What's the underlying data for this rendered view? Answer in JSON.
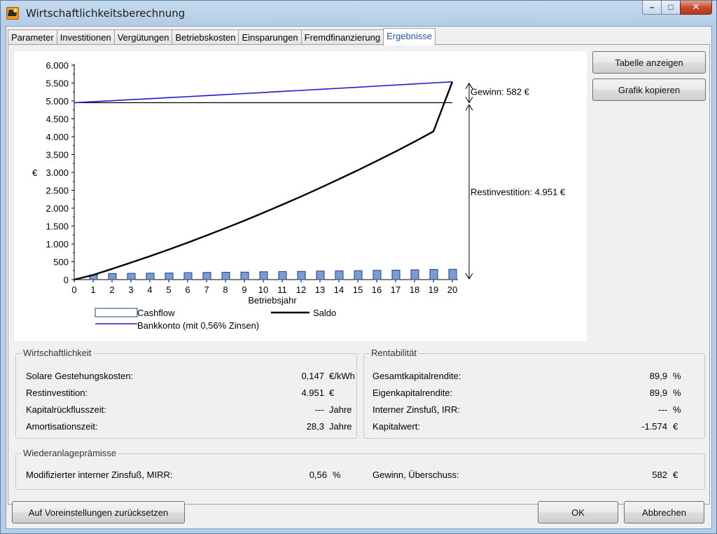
{
  "window": {
    "title": "Wirtschaftlichkeitsberechnung"
  },
  "tabs": [
    "Parameter",
    "Investitionen",
    "Vergütungen",
    "Betriebskosten",
    "Einsparungen",
    "Fremdfinanzierung",
    "Ergebnisse"
  ],
  "active_tab": "Ergebnisse",
  "buttons": {
    "show_table": "Tabelle anzeigen",
    "copy_chart": "Grafik kopieren",
    "reset": "Auf Voreinstellungen zurücksetzen",
    "ok": "OK",
    "cancel": "Abbrechen"
  },
  "colors": {
    "bankkonto": "#1c1cd6",
    "saldo": "#000000",
    "cashflow_fill": "#7a9cd0",
    "cashflow_stroke": "#1f3f8a",
    "active_tab_text": "#1f56a6"
  },
  "chart_data": {
    "type": "bar+line",
    "xlabel": "Betriebsjahr",
    "ylabel": "€",
    "x": [
      0,
      1,
      2,
      3,
      4,
      5,
      6,
      7,
      8,
      9,
      10,
      11,
      12,
      13,
      14,
      15,
      16,
      17,
      18,
      19,
      20
    ],
    "ylim": [
      0,
      6000
    ],
    "yticks": [
      0,
      500,
      1000,
      1500,
      2000,
      2500,
      3000,
      3500,
      4000,
      4500,
      5000,
      5500,
      6000
    ],
    "ytick_labels": [
      "0",
      "500",
      "1.000",
      "1.500",
      "2.000",
      "2.500",
      "3.000",
      "3.500",
      "4.000",
      "4.500",
      "5.000",
      "5.500",
      "6.000"
    ],
    "reference_line": 4951,
    "series": [
      {
        "name": "Cashflow",
        "type": "bar",
        "x": [
          1,
          2,
          3,
          4,
          5,
          6,
          7,
          8,
          9,
          10,
          11,
          12,
          13,
          14,
          15,
          16,
          17,
          18,
          19,
          20
        ],
        "values": [
          130,
          170,
          175,
          180,
          185,
          195,
          200,
          205,
          210,
          220,
          225,
          230,
          240,
          245,
          250,
          260,
          265,
          275,
          285,
          290
        ]
      },
      {
        "name": "Saldo",
        "type": "line",
        "values": [
          0,
          130,
          300,
          475,
          655,
          840,
          1035,
          1235,
          1440,
          1650,
          1870,
          2095,
          2325,
          2565,
          2810,
          3060,
          3320,
          3585,
          3860,
          4145,
          5533
        ]
      },
      {
        "name": "Bankkonto (mit 0,56% Zinsen)",
        "type": "line",
        "values": [
          4951,
          4979,
          5007,
          5035,
          5063,
          5091,
          5120,
          5148,
          5177,
          5206,
          5235,
          5265,
          5294,
          5324,
          5353,
          5383,
          5414,
          5444,
          5474,
          5505,
          5533
        ]
      }
    ],
    "annotations": [
      {
        "text": "Gewinn: 582 €",
        "from": 4951,
        "to": 5533
      },
      {
        "text": "Restinvestition: 4.951 €",
        "from": 0,
        "to": 4951
      }
    ],
    "legend": [
      "Cashflow",
      "Saldo",
      "Bankkonto (mit 0,56% Zinsen)"
    ],
    "legend_position": "bottom",
    "grid": false
  },
  "wirtschaftlichkeit": {
    "title": "Wirtschaftlichkeit",
    "rows": [
      {
        "label": "Solare Gestehungskosten:",
        "value": "0,147",
        "unit": "€/kWh"
      },
      {
        "label": "Restinvestition:",
        "value": "4.951",
        "unit": "€"
      },
      {
        "label": "Kapitalrückflusszeit:",
        "value": "---",
        "unit": "Jahre"
      },
      {
        "label": "Amortisationszeit:",
        "value": "28,3",
        "unit": "Jahre"
      }
    ]
  },
  "rentabilitaet": {
    "title": "Rentabilität",
    "rows": [
      {
        "label": "Gesamtkapitalrendite:",
        "value": "89,9",
        "unit": "%"
      },
      {
        "label": "Eigenkapitalrendite:",
        "value": "89,9",
        "unit": "%"
      },
      {
        "label": "Interner Zinsfuß, IRR:",
        "value": "---",
        "unit": "%"
      },
      {
        "label": "Kapitalwert:",
        "value": "-1.574",
        "unit": "€"
      }
    ]
  },
  "wiederanlage": {
    "title": "Wiederanlageprämisse",
    "mirr_label": "Modifizierter interner Zinsfuß, MIRR:",
    "mirr_value": "0,56",
    "mirr_unit": "%",
    "gewinn_label": "Gewinn, Überschuss:",
    "gewinn_value": "582",
    "gewinn_unit": "€"
  }
}
